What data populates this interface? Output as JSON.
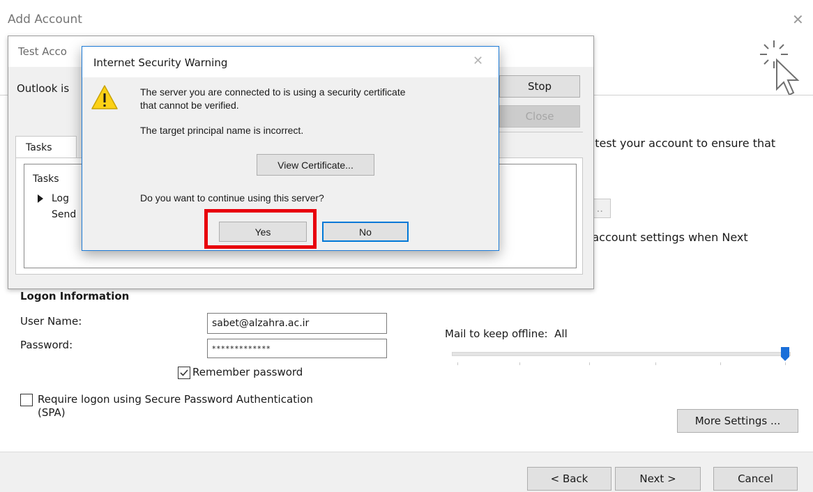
{
  "window": {
    "title": "Add Account",
    "close_glyph": "✕"
  },
  "background": {
    "header_text_partial": "u test your account to ensure that",
    "test_button_partial": "..",
    "settings_text_partial": "t account settings when Next",
    "logon_section_title": "Logon Information",
    "username_label": "User Name:",
    "username_value": "sabet@alzahra.ac.ir",
    "password_label": "Password:",
    "password_value": "*************",
    "remember_password_label": "Remember password",
    "remember_password_checked": true,
    "spa_label_line1": "Require logon using Secure Password Authentication",
    "spa_label_line2": "(SPA)",
    "spa_checked": false,
    "mail_offline_label": "Mail to keep offline:",
    "mail_offline_value": "All",
    "more_settings_label": "More Settings ...",
    "back_label": "< Back",
    "next_label": "Next >",
    "cancel_label": "Cancel"
  },
  "test_dialog": {
    "title_partial": "Test Acco",
    "status_partial": "Outlook is",
    "stop_label": "Stop",
    "close_label": "Close",
    "tab_label": "Tasks",
    "tasks_header": "Tasks",
    "task_1_partial": "Log",
    "task_2_partial": "Send"
  },
  "security_dialog": {
    "title": "Internet Security Warning",
    "message_line1": "The server you are connected to is using a security certificate",
    "message_line2": "that cannot be verified.",
    "message_line3": "The target principal name is incorrect.",
    "view_certificate_label": "View Certificate...",
    "question": "Do you want to continue using this server?",
    "yes_label": "Yes",
    "no_label": "No",
    "highlight_color": "#e8000b",
    "accent_color": "#0078d7"
  }
}
